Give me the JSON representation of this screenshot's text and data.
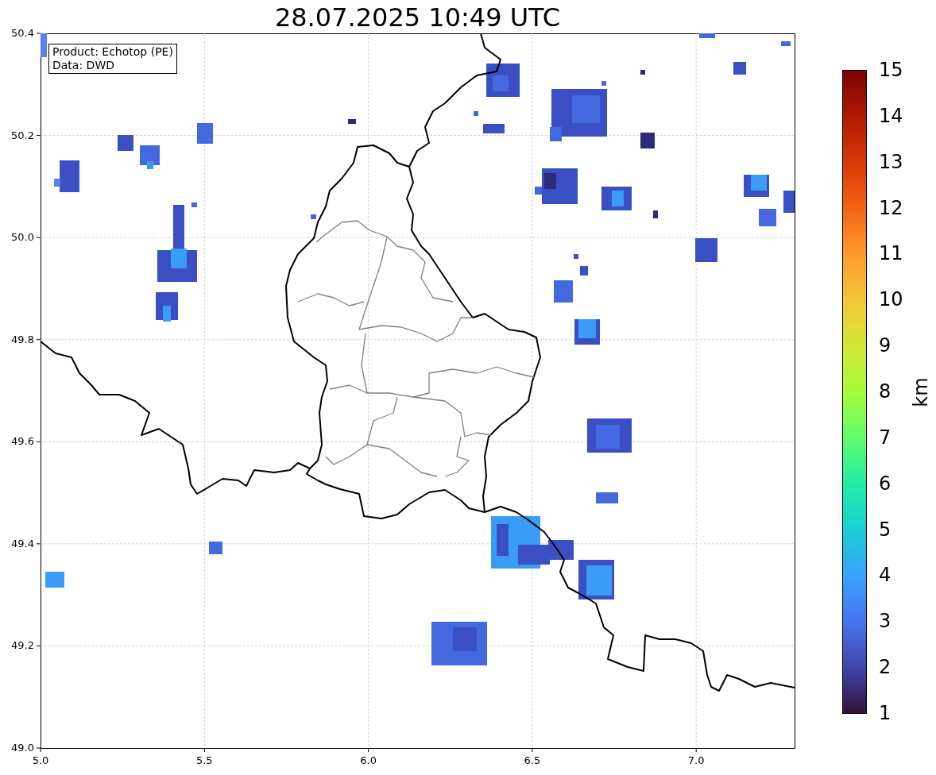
{
  "title": "28.07.2025 10:49 UTC",
  "info_box": [
    "Product: Echotop (PE)",
    "Data: DWD"
  ],
  "x_ticks": [
    "5.0",
    "5.5",
    "6.0",
    "6.5",
    "7.0"
  ],
  "y_ticks": [
    "50.4",
    "50.2",
    "50.0",
    "49.8",
    "49.6",
    "49.4",
    "49.2",
    "49.0"
  ],
  "colorbar": {
    "label": "km",
    "ticks": [
      "15",
      "14",
      "13",
      "12",
      "11",
      "10",
      "9",
      "8",
      "7",
      "6",
      "5",
      "4",
      "3",
      "2",
      "1"
    ]
  }
}
